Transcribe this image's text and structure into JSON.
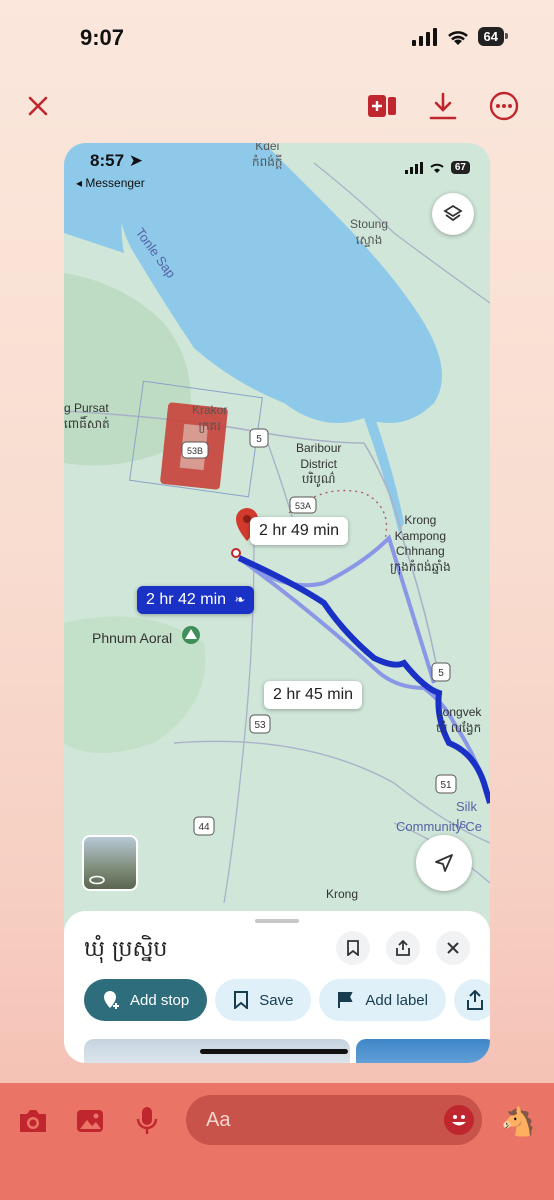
{
  "status_bar": {
    "time": "9:07",
    "battery": "64"
  },
  "toolbar": {
    "close_icon": "close-icon",
    "add_icon": "add-to-story-icon",
    "download_icon": "download-icon",
    "more_icon": "more-icon"
  },
  "screenshot": {
    "status": {
      "time": "8:57",
      "back_label": "◂ Messenger",
      "battery": "67"
    },
    "map": {
      "labels": {
        "kdei": "Kdei",
        "kdei_km": "កំពង់ក្តី",
        "stoung": "Stoung",
        "stoung_km": "ស្ទោង",
        "tonle_sap": "Tonle Sap",
        "pursat": "g Pursat",
        "pursat_km": "ពោធិ៍សាត់",
        "krakor": "Krakor",
        "krakor_km": "ក្រគរ",
        "baribour": "Baribour",
        "district": "District",
        "baribour_km": "បរិបូណ៌",
        "kampong_chhnang_1": "Krong",
        "kampong_chhnang_2": "Kampong",
        "kampong_chhnang_3": "Chhnang",
        "kampong_chhnang_km": "ក្រុងកំពង់ឆ្នាំង",
        "phnum_aoral": "Phnum Aoral",
        "longvek": "Longvek",
        "longvek_km": "ឃុំ លង្វែក",
        "silk_is": "Silk Is",
        "community": "Community Ce",
        "krong_bottom": "Krong",
        "road_5a": "5",
        "road_53b": "53B",
        "road_53a": "53A",
        "road_5b": "5",
        "road_53": "53",
        "road_44": "44",
        "road_51": "51"
      },
      "route_times": {
        "top": "2 hr 49 min",
        "primary": "2 hr 42 min",
        "alt": "2 hr 45 min"
      },
      "colors": {
        "route_primary": "#1a31c6",
        "route_alt": "#8a97e6",
        "water": "#8ec9ea",
        "land": "#cfe6d8"
      }
    },
    "sheet": {
      "place_name": "ឃុំ ប្រស្និប",
      "chips": {
        "add_stop": "Add stop",
        "save": "Save",
        "add_label": "Add label"
      }
    }
  },
  "composer": {
    "placeholder": "Aa"
  }
}
